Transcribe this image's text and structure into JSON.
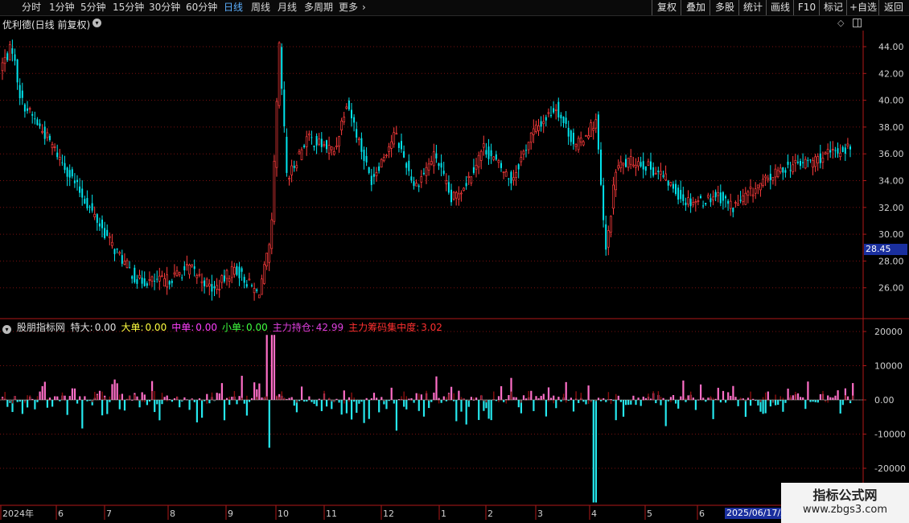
{
  "toolbar": {
    "timeframes": [
      "分时",
      "1分钟",
      "5分钟",
      "15分钟",
      "30分钟",
      "60分钟",
      "日线",
      "周线",
      "月线",
      "多周期",
      "更多"
    ],
    "right_buttons": [
      "复权",
      "叠加",
      "多股",
      "统计",
      "画线",
      "F10",
      "标记",
      "+自选",
      "返回"
    ]
  },
  "main_chart": {
    "title": "优利德(日线 前复权)",
    "current_price": "28.45",
    "y_ticks": [
      "44.00",
      "42.00",
      "40.00",
      "38.00",
      "36.00",
      "34.00",
      "32.00",
      "30.00",
      "28.00",
      "26.00"
    ],
    "colors": {
      "up": "#ff3c3c",
      "down": "#00e5ee",
      "grid": "#7a1010",
      "axis": "#b01818"
    }
  },
  "indicator": {
    "name": "股朋指标网",
    "fields": [
      {
        "label": "特大:",
        "value": "0.00",
        "color": "#e0e0e0"
      },
      {
        "label": "大单:",
        "value": "0.00",
        "color": "#ffff40"
      },
      {
        "label": "中单:",
        "value": "0.00",
        "color": "#ff40ff"
      },
      {
        "label": "小单:",
        "value": "0.00",
        "color": "#40ff40"
      },
      {
        "label": "主力持仓:",
        "value": "42.99",
        "color": "#e040e0"
      },
      {
        "label": "主力筹码集中度:",
        "value": "3.02",
        "color": "#ff3030"
      }
    ],
    "y_ticks": [
      "20000",
      "10000",
      "0.00",
      "-10000",
      "-20000"
    ]
  },
  "x_axis": {
    "labels": [
      "2024年",
      "6",
      "7",
      "8",
      "9",
      "10",
      "11",
      "12",
      "1",
      "2",
      "3",
      "4",
      "5",
      "6"
    ],
    "selected_date": "2025/06/17/二"
  },
  "watermark": {
    "title": "指标公式网",
    "url": "www.zbgs3.com"
  }
}
